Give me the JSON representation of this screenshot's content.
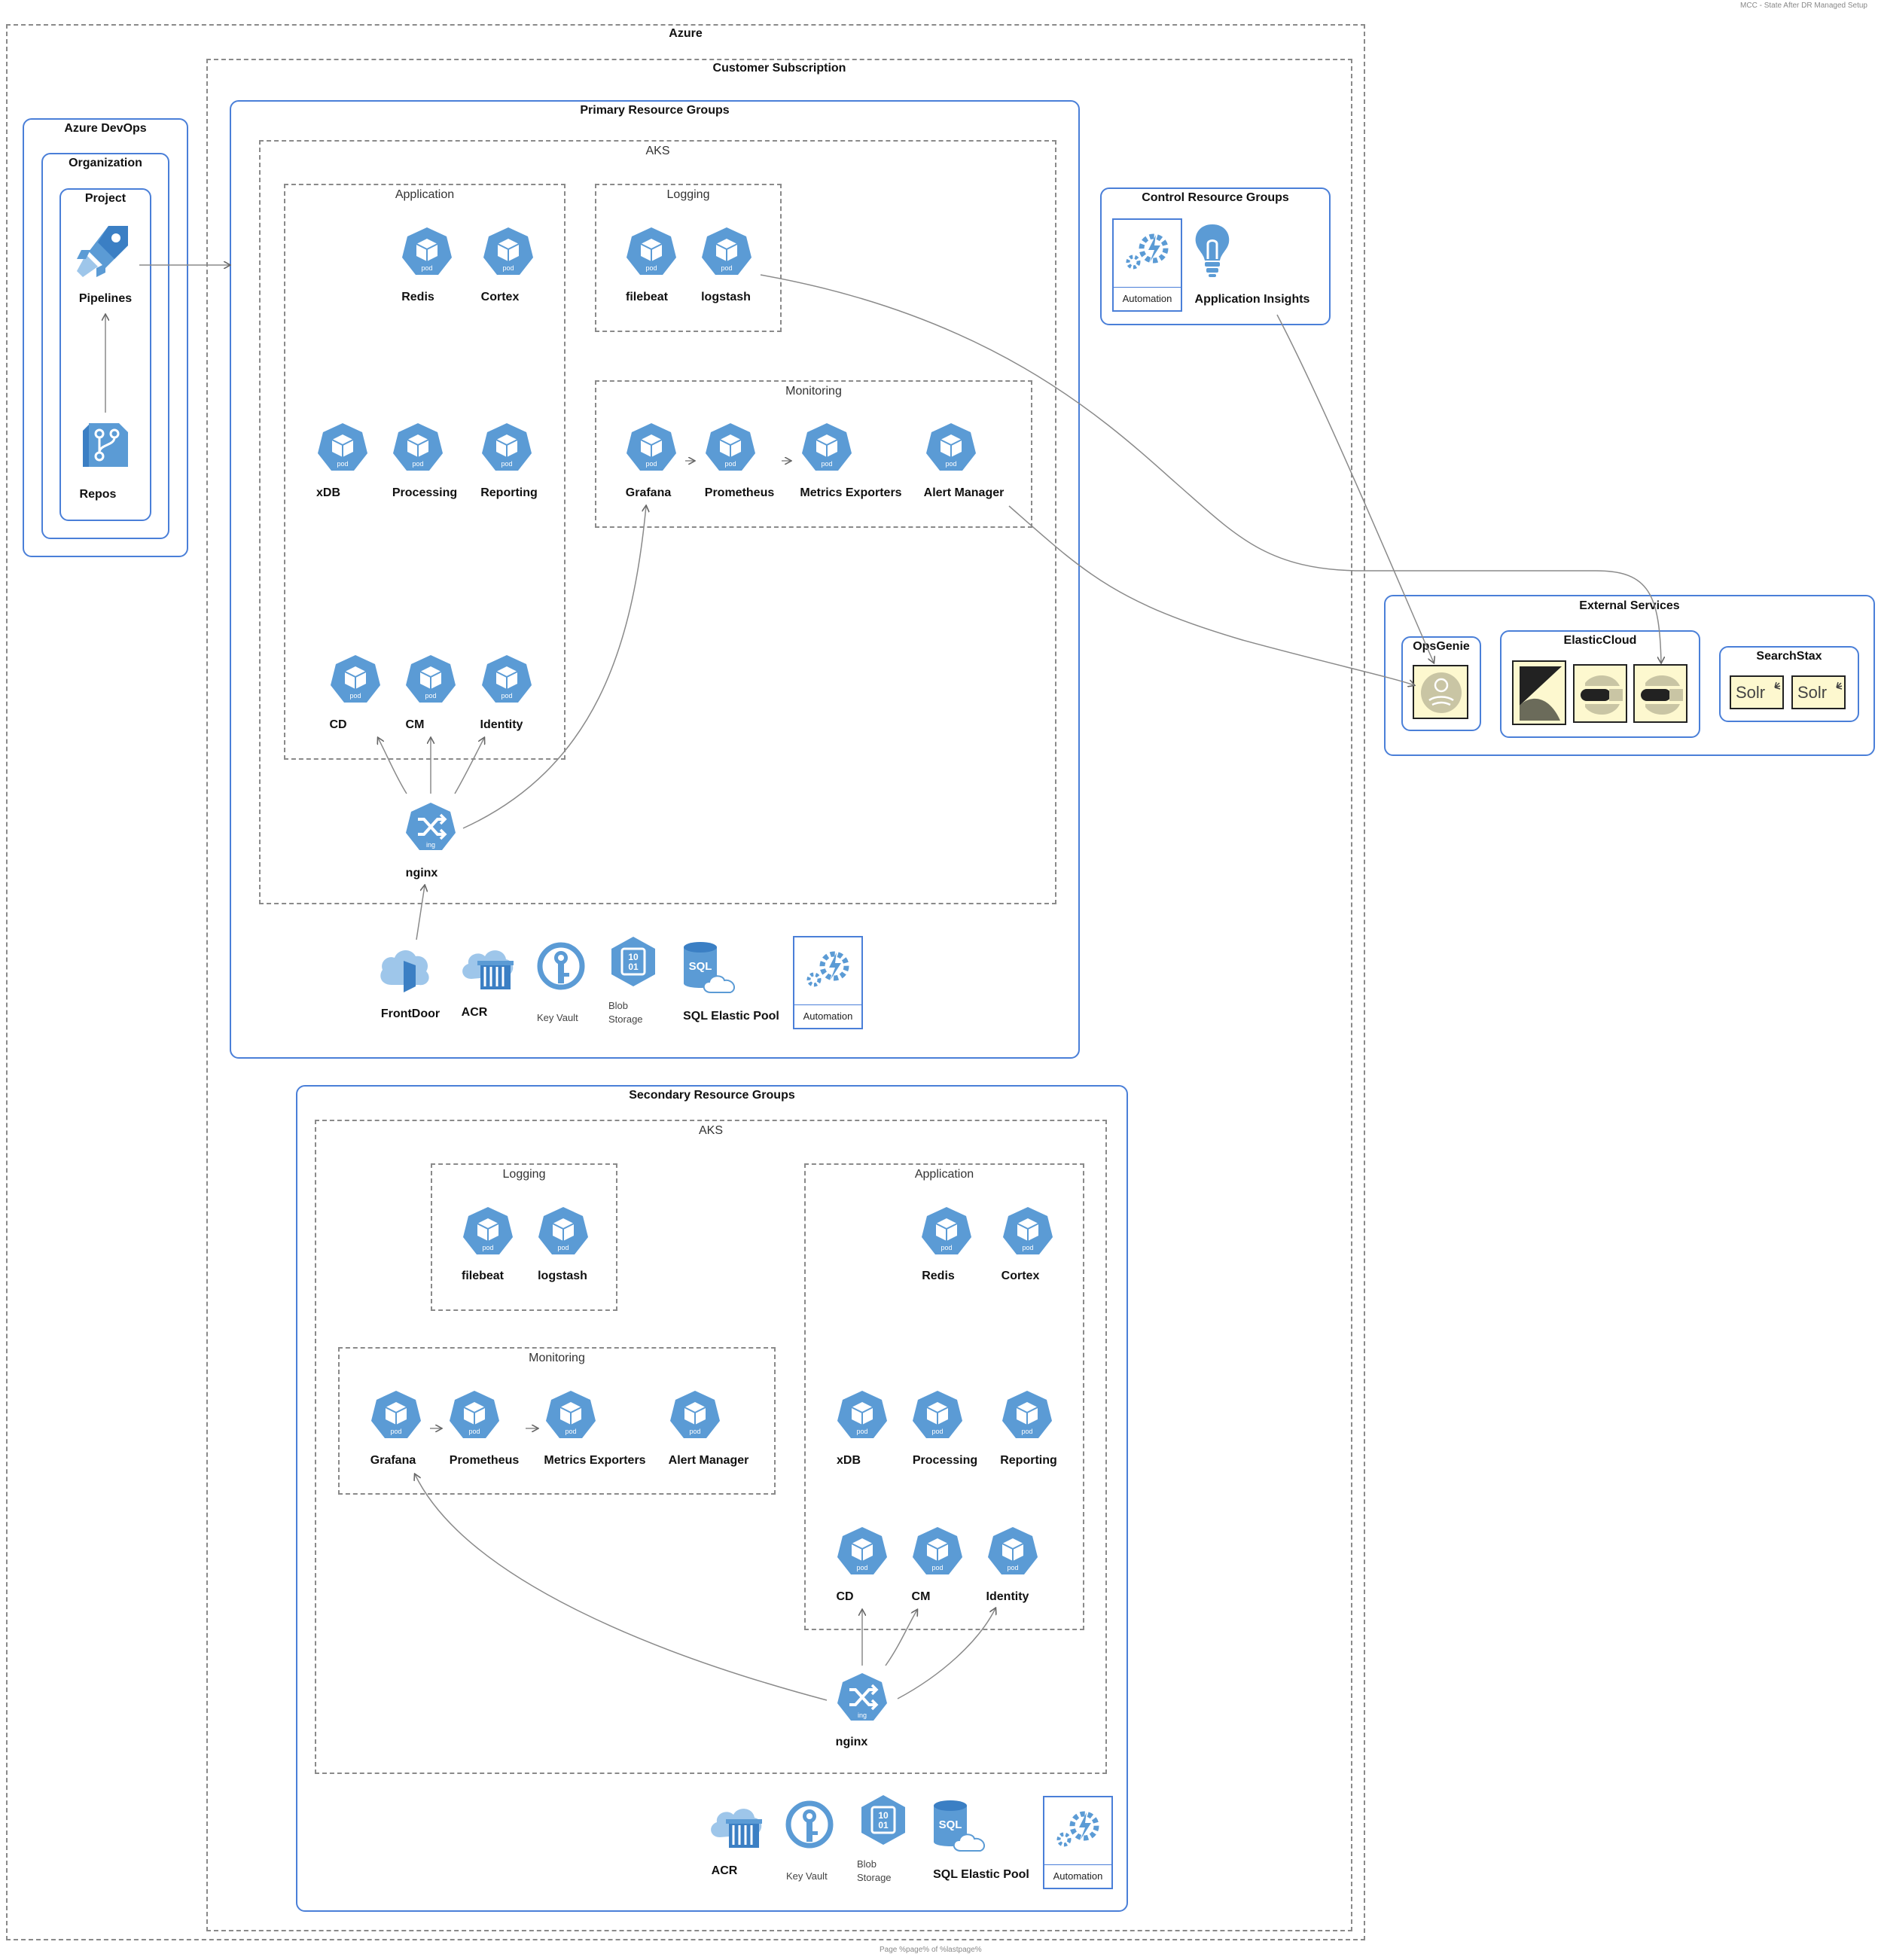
{
  "page": {
    "header_right": "MCC - State After DR Managed Setup",
    "footer": "Page %page% of %lastpage%"
  },
  "azure": {
    "title": "Azure"
  },
  "devops": {
    "title": "Azure DevOps",
    "organization": "Organization",
    "project": "Project",
    "pipelines": "Pipelines",
    "repos": "Repos"
  },
  "subscription": {
    "title": "Customer Subscription"
  },
  "primary": {
    "title": "Primary Resource Groups",
    "aks": "AKS",
    "application": {
      "title": "Application",
      "pods": [
        "Redis",
        "Cortex",
        "xDB",
        "Processing",
        "Reporting",
        "CD",
        "CM",
        "Identity"
      ]
    },
    "logging": {
      "title": "Logging",
      "pods": [
        "filebeat",
        "logstash"
      ]
    },
    "monitoring": {
      "title": "Monitoring",
      "pods": [
        "Grafana",
        "Prometheus",
        "Metrics Exporters",
        "Alert Manager"
      ]
    },
    "ingress": "nginx",
    "resources": {
      "frontdoor": "FrontDoor",
      "acr": "ACR",
      "keyvault": "Key Vault",
      "blob_line1": "Blob",
      "blob_line2": "Storage",
      "sql": "SQL Elastic Pool",
      "automation": "Automation"
    }
  },
  "secondary": {
    "title": "Secondary Resource Groups",
    "aks": "AKS",
    "logging": {
      "title": "Logging",
      "pods": [
        "filebeat",
        "logstash"
      ]
    },
    "monitoring": {
      "title": "Monitoring",
      "pods": [
        "Grafana",
        "Prometheus",
        "Metrics Exporters",
        "Alert Manager"
      ]
    },
    "application": {
      "title": "Application",
      "pods": [
        "Redis",
        "Cortex",
        "xDB",
        "Processing",
        "Reporting",
        "CD",
        "CM",
        "Identity"
      ]
    },
    "ingress": "nginx",
    "resources": {
      "acr": "ACR",
      "keyvault": "Key Vault",
      "blob_line1": "Blob",
      "blob_line2": "Storage",
      "sql": "SQL Elastic Pool",
      "automation": "Automation"
    }
  },
  "control": {
    "title": "Control Resource Groups",
    "automation": "Automation",
    "appinsights": "Application Insights"
  },
  "external": {
    "title": "External Services",
    "opsgenie": "OpsGenie",
    "elastic": "ElasticCloud",
    "searchstax": "SearchStax",
    "solr": "Solr"
  },
  "icons": {
    "pod": "kubernetes-pod-icon",
    "pod_text": "pod",
    "ingress_text": "ing",
    "colors": {
      "azure_blue": "#5b9bd5",
      "border_blue": "#4a7fd8",
      "external_fill": "#fdf8cf"
    }
  }
}
